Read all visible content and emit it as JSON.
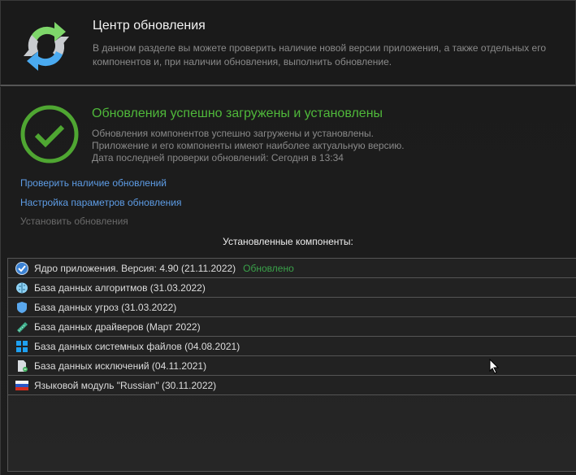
{
  "header": {
    "title": "Центр обновления",
    "description": "В данном разделе вы можете проверить наличие новой версии приложения, а также отдельных его компонентов и, при наличии обновления, выполнить обновление."
  },
  "status": {
    "title": "Обновления успешно загружены и установлены",
    "lines": [
      "Обновления компонентов успешно загружены и установлены.",
      "Приложение и его компоненты имеют наиболее актуальную версию.",
      "Дата последней проверки обновлений: Сегодня в 13:34"
    ]
  },
  "links": {
    "check": "Проверить наличие обновлений",
    "settings": "Настройка параметров обновления",
    "install": "Установить обновления"
  },
  "components": {
    "title": "Установленные компоненты:",
    "items": [
      {
        "label": "Ядро приложения. Версия: 4.90 (21.11.2022)",
        "badge": "Обновлено",
        "icon": "check-badge-icon"
      },
      {
        "label": "База данных алгоритмов (31.03.2022)",
        "icon": "brain-icon"
      },
      {
        "label": "База данных угроз (31.03.2022)",
        "icon": "shield-icon"
      },
      {
        "label": "База данных драйверов (Март 2022)",
        "icon": "memory-chip-icon"
      },
      {
        "label": "База данных системных файлов (04.08.2021)",
        "icon": "windows-icon"
      },
      {
        "label": "База данных исключений (04.11.2021)",
        "icon": "document-icon"
      },
      {
        "label": "Языковой модуль \"Russian\" (30.11.2022)",
        "icon": "russian-flag-icon"
      }
    ]
  },
  "colors": {
    "accent_green": "#4fb83a",
    "link_blue": "#5e9de6"
  }
}
